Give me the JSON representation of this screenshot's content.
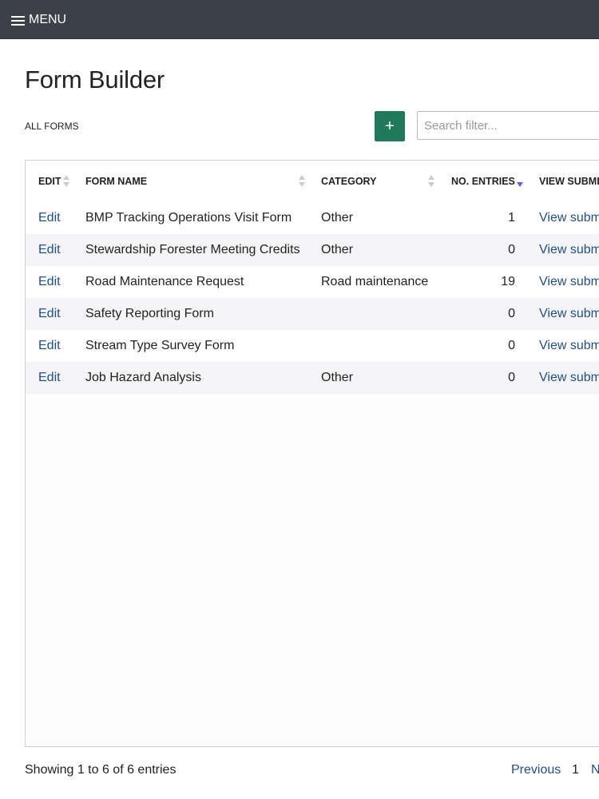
{
  "topbar": {
    "menu_label": "MENU"
  },
  "page": {
    "title": "Form Builder",
    "section_label": "ALL FORMS"
  },
  "toolbar": {
    "add_label": "+",
    "search_placeholder": "Search filter..."
  },
  "table": {
    "headers": {
      "edit": "EDIT",
      "form_name": "FORM NAME",
      "category": "CATEGORY",
      "entries": "NO. ENTRIES",
      "view": "VIEW SUBMI"
    },
    "rows": [
      {
        "edit": "Edit",
        "name": "BMP Tracking Operations Visit Form",
        "category": "Other",
        "entries": "1",
        "view": "View subm"
      },
      {
        "edit": "Edit",
        "name": "Stewardship Forester Meeting Credits",
        "category": "Other",
        "entries": "0",
        "view": "View subm"
      },
      {
        "edit": "Edit",
        "name": "Road Maintenance Request",
        "category": "Road maintenance",
        "entries": "19",
        "view": "View subm"
      },
      {
        "edit": "Edit",
        "name": "Safety Reporting Form",
        "category": "",
        "entries": "0",
        "view": "View subm"
      },
      {
        "edit": "Edit",
        "name": "Stream Type Survey Form",
        "category": "",
        "entries": "0",
        "view": "View subm"
      },
      {
        "edit": "Edit",
        "name": "Job Hazard Analysis",
        "category": "Other",
        "entries": "0",
        "view": "View subm"
      }
    ]
  },
  "footer": {
    "info": "Showing 1 to 6 of 6 entries",
    "previous": "Previous",
    "current_page": "1",
    "next": "N"
  },
  "colors": {
    "topbar": "#3c4149",
    "accent": "#1f7a5a",
    "link": "#1f4e8c"
  }
}
